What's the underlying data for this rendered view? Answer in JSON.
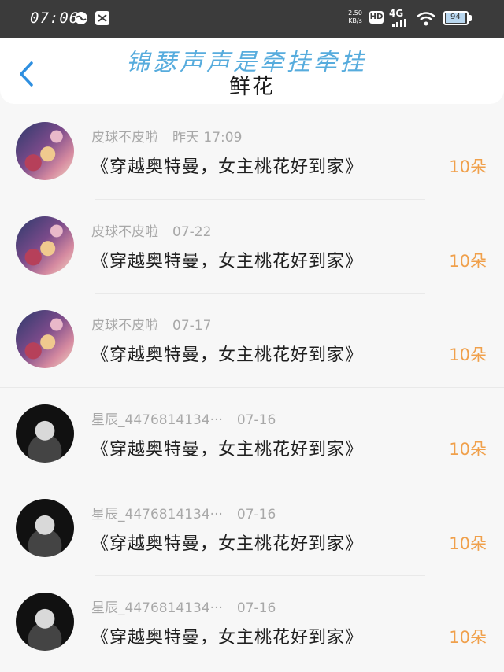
{
  "status_bar": {
    "time": "07:06",
    "net_speed": "2.50",
    "net_speed_unit": "KB/s",
    "hd": "HD",
    "network": "4G",
    "battery": "94"
  },
  "header": {
    "title": "鲜花",
    "watermark": "锦瑟声声是牵挂牵挂"
  },
  "list": [
    {
      "user": "皮球不皮啦",
      "time": "昨天 17:09",
      "title": "《穿越奥特曼，女主桃花好到家》",
      "count": "10朵",
      "avatar": "anime"
    },
    {
      "user": "皮球不皮啦",
      "time": "07-22",
      "title": "《穿越奥特曼，女主桃花好到家》",
      "count": "10朵",
      "avatar": "anime"
    },
    {
      "user": "皮球不皮啦",
      "time": "07-17",
      "title": "《穿越奥特曼，女主桃花好到家》",
      "count": "10朵",
      "avatar": "anime"
    },
    {
      "user": "星辰_4476814134···",
      "time": "07-16",
      "title": "《穿越奥特曼，女主桃花好到家》",
      "count": "10朵",
      "avatar": "mono"
    },
    {
      "user": "星辰_4476814134···",
      "time": "07-16",
      "title": "《穿越奥特曼，女主桃花好到家》",
      "count": "10朵",
      "avatar": "mono"
    },
    {
      "user": "星辰_4476814134···",
      "time": "07-16",
      "title": "《穿越奥特曼，女主桃花好到家》",
      "count": "10朵",
      "avatar": "mono"
    }
  ]
}
